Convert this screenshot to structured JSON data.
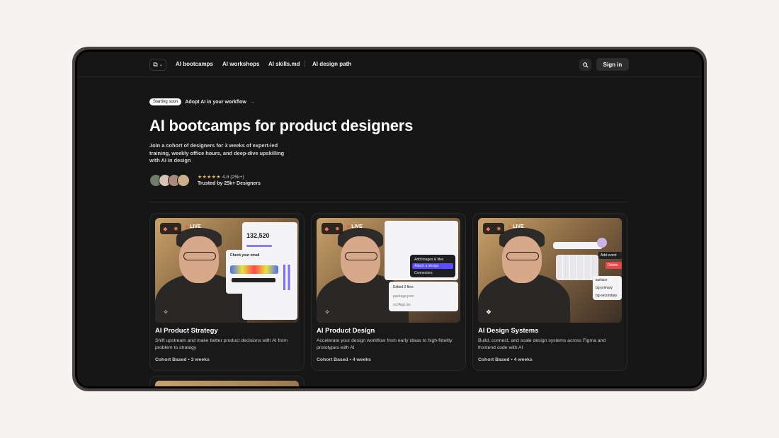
{
  "nav": {
    "links": [
      "AI bootcamps",
      "AI workshops",
      "AI skills.md",
      "AI design path"
    ],
    "signin": "Sign in"
  },
  "hero": {
    "pill_tag": "Starting soon",
    "pill_text": "Adopt AI in your workflow",
    "title": "AI bootcamps for product designers",
    "subtitle": "Join a cohort of designers for 3 weeks of expert-led training, weekly office hours, and deep-dive upskilling with AI in design",
    "rating": "4.8 (25k+)",
    "trusted": "Trusted by 25k+ Designers"
  },
  "cards": [
    {
      "title": "AI Product Strategy",
      "desc": "Shift upstream and make better product decisions with AI from problem to strategy",
      "meta": "Cohort Based • 3 weeks",
      "live": "LIVE",
      "panel_value": "132,520",
      "panel_caption": "Check your email"
    },
    {
      "title": "AI Product Design",
      "desc": "Accelerate your design workflow from early ideas to high-fidelity prototypes with AI",
      "meta": "Cohort Based • 4 weeks",
      "live": "LIVE",
      "panel_menu": [
        "Add images & files",
        "Attach a design",
        "Connectors"
      ],
      "panel_list": [
        "Edited 2 files",
        "package.json",
        "src/App.tsx"
      ]
    },
    {
      "title": "AI Design Systems",
      "desc": "Build, connect, and scale design systems across Figma and frontend code with AI",
      "meta": "Cohort Based • 4 weeks",
      "live": "LIVE",
      "panel_actions": [
        "Add event",
        "Delete"
      ],
      "panel_tokens": [
        "surface",
        "bg-primary",
        "bg-secondary"
      ]
    }
  ],
  "colors": {
    "accent": "#6b5cff",
    "live_dot": "#ff4a4a",
    "stars": "#f0b85a"
  }
}
